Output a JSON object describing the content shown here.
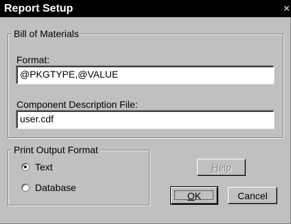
{
  "window": {
    "title": "Report Setup",
    "close_glyph": "×"
  },
  "bom": {
    "legend": "Bill of Materials",
    "format_label": "Format:",
    "format_value": "@PKGTYPE,@VALUE",
    "cdf_label": "Component Description File:",
    "cdf_value": "user.cdf"
  },
  "print_output": {
    "legend": "Print Output Format",
    "options": [
      {
        "label": "Text",
        "selected": true
      },
      {
        "label": "Database",
        "selected": false
      }
    ]
  },
  "buttons": {
    "help_mnemonic": "H",
    "help_rest": "elp",
    "ok_mnemonic": "O",
    "ok_rest": "K",
    "cancel": "Cancel"
  },
  "colors": {
    "titlebar": "#000000",
    "face": "#c0c0c0",
    "field": "#ffffff"
  }
}
